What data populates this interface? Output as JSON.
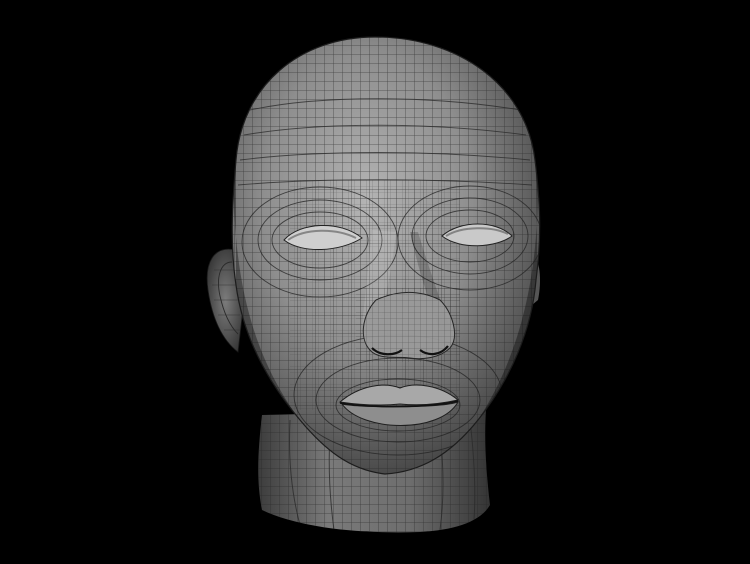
{
  "scene": {
    "subject": "head-mesh",
    "background_color": "#000000",
    "surface_color": "#8c8c8c",
    "wire_color": "#2a2a2a"
  }
}
